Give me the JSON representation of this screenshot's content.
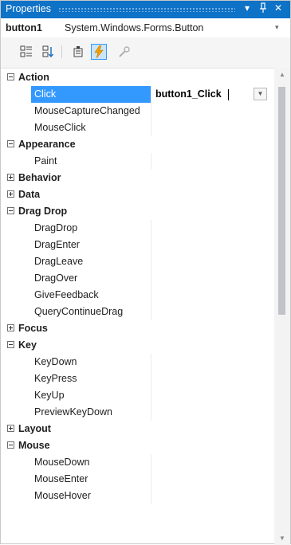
{
  "window": {
    "title": "Properties",
    "dropdown_icon": "▾",
    "pin_icon": "ꟾ",
    "close_icon": "✕"
  },
  "object_selector": {
    "name": "button1",
    "type": "System.Windows.Forms.Button",
    "arrow": "▾"
  },
  "toolbar": {
    "categorized_icon": "categorized-icon",
    "alphabetical_icon": "alphabetical-icon",
    "properties_icon": "properties-icon",
    "events_icon": "events-icon",
    "property_pages_icon": "property-pages-icon",
    "active": "events"
  },
  "grid": {
    "selected_value": "button1_Click",
    "rows": [
      {
        "type": "category",
        "label": "Action",
        "expanded": true
      },
      {
        "type": "property",
        "label": "Click",
        "selected": true
      },
      {
        "type": "property",
        "label": "MouseCaptureChanged"
      },
      {
        "type": "property",
        "label": "MouseClick"
      },
      {
        "type": "category",
        "label": "Appearance",
        "expanded": true
      },
      {
        "type": "property",
        "label": "Paint"
      },
      {
        "type": "category",
        "label": "Behavior",
        "expanded": false
      },
      {
        "type": "category",
        "label": "Data",
        "expanded": false
      },
      {
        "type": "category",
        "label": "Drag Drop",
        "expanded": true
      },
      {
        "type": "property",
        "label": "DragDrop"
      },
      {
        "type": "property",
        "label": "DragEnter"
      },
      {
        "type": "property",
        "label": "DragLeave"
      },
      {
        "type": "property",
        "label": "DragOver"
      },
      {
        "type": "property",
        "label": "GiveFeedback"
      },
      {
        "type": "property",
        "label": "QueryContinueDrag"
      },
      {
        "type": "category",
        "label": "Focus",
        "expanded": false
      },
      {
        "type": "category",
        "label": "Key",
        "expanded": true
      },
      {
        "type": "property",
        "label": "KeyDown"
      },
      {
        "type": "property",
        "label": "KeyPress"
      },
      {
        "type": "property",
        "label": "KeyUp"
      },
      {
        "type": "property",
        "label": "PreviewKeyDown"
      },
      {
        "type": "category",
        "label": "Layout",
        "expanded": false
      },
      {
        "type": "category",
        "label": "Mouse",
        "expanded": true
      },
      {
        "type": "property",
        "label": "MouseDown"
      },
      {
        "type": "property",
        "label": "MouseEnter"
      },
      {
        "type": "property",
        "label": "MouseHover"
      }
    ]
  },
  "scrollbar": {
    "up_arrow": "▲",
    "down_arrow": "▼"
  }
}
